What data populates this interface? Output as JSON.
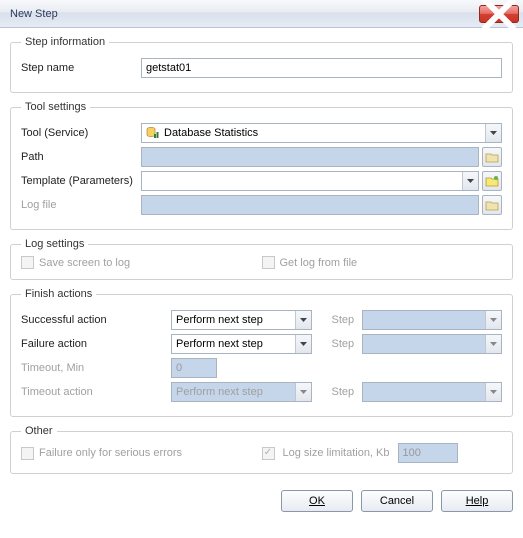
{
  "window": {
    "title": "New Step"
  },
  "step_info": {
    "legend": "Step information",
    "step_name_label": "Step name",
    "step_name_value": "getstat01"
  },
  "tool_settings": {
    "legend": "Tool settings",
    "tool_label": "Tool (Service)",
    "tool_value": "Database Statistics",
    "path_label": "Path",
    "path_value": "",
    "template_label": "Template (Parameters)",
    "template_value": "",
    "logfile_label": "Log file",
    "logfile_value": ""
  },
  "log_settings": {
    "legend": "Log settings",
    "save_screen_label": "Save screen to log",
    "get_log_label": "Get log from file"
  },
  "finish": {
    "legend": "Finish actions",
    "success_label": "Successful action",
    "success_value": "Perform next step",
    "failure_label": "Failure action",
    "failure_value": "Perform next step",
    "timeout_label": "Timeout, Min",
    "timeout_value": "0",
    "timeout_action_label": "Timeout action",
    "timeout_action_value": "Perform next step",
    "step_label": "Step",
    "step_success_value": "",
    "step_failure_value": "",
    "step_timeout_value": ""
  },
  "other": {
    "legend": "Other",
    "serious_label": "Failure only for serious errors",
    "logsize_label": "Log size limitation, Kb",
    "logsize_value": "100"
  },
  "buttons": {
    "ok": "OK",
    "cancel": "Cancel",
    "help": "Help"
  }
}
